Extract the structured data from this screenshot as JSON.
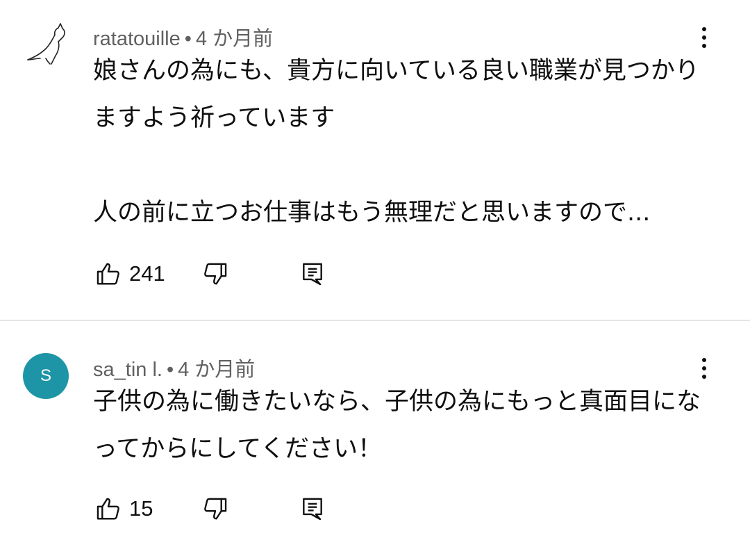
{
  "comments": [
    {
      "author": "ratatouille",
      "separator": "•",
      "time": "4 か月前",
      "avatar_type": "cat-line-drawing",
      "text": "娘さんの為にも、貴方に向いている良い職業が見つかりますよう祈っています\n\n人の前に立つお仕事はもう無理だと思いますので...",
      "likes": "241",
      "menu_icon": "more-vert-icon",
      "like_icon": "thumb-up-icon",
      "dislike_icon": "thumb-down-icon",
      "reply_icon": "reply-icon"
    },
    {
      "author": "sa_tin l.",
      "separator": "•",
      "time": "4 か月前",
      "avatar_letter": "S",
      "avatar_color": "#1e95a6",
      "text": "子供の為に働きたいなら、子供の為にもっと真面目になってからにしてください！",
      "likes": "15",
      "menu_icon": "more-vert-icon",
      "like_icon": "thumb-up-icon",
      "dislike_icon": "thumb-down-icon",
      "reply_icon": "reply-icon"
    }
  ]
}
